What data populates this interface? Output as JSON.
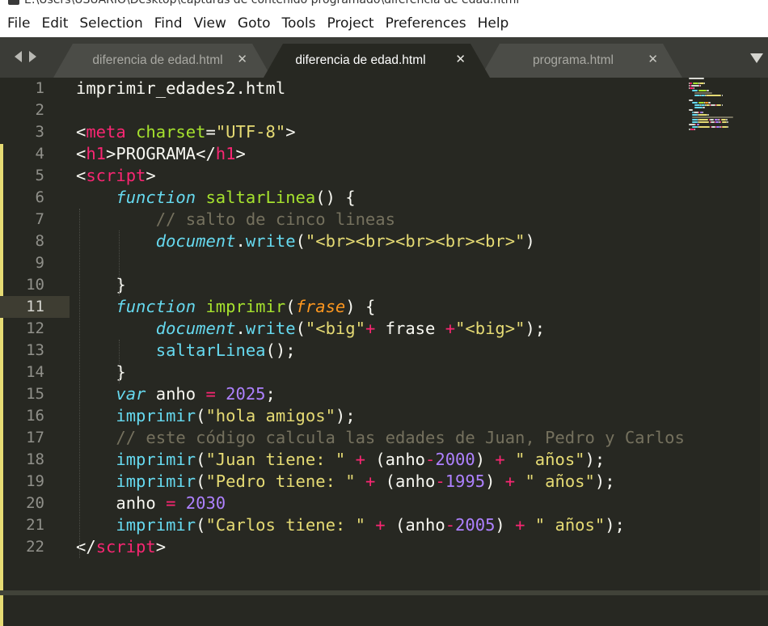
{
  "window": {
    "title": "E:\\Users\\USUARIO\\Desktop\\capturas de contenido programado\\diferencia de edad.html"
  },
  "menu": [
    "File",
    "Edit",
    "Selection",
    "Find",
    "View",
    "Goto",
    "Tools",
    "Project",
    "Preferences",
    "Help"
  ],
  "tabs": [
    {
      "label": "diferencia de edad.html",
      "active": false
    },
    {
      "label": "diferencia de edad.html",
      "active": true
    },
    {
      "label": "programa.html",
      "active": false
    }
  ],
  "tab_close_glyph": "✕",
  "editor": {
    "current_line": 11,
    "lines": [
      {
        "n": "1",
        "tokens": [
          [
            "t",
            "imprimir_edades2.html"
          ]
        ]
      },
      {
        "n": "2",
        "tokens": []
      },
      {
        "n": "3",
        "tokens": [
          [
            "t",
            "<"
          ],
          [
            "kw",
            "meta"
          ],
          [
            "t",
            " "
          ],
          [
            "attr",
            "charset"
          ],
          [
            "t",
            "="
          ],
          [
            "str",
            "\"UTF-8\""
          ],
          [
            "t",
            ">"
          ]
        ]
      },
      {
        "n": "4",
        "tokens": [
          [
            "t",
            "<"
          ],
          [
            "kw",
            "h1"
          ],
          [
            "t",
            ">PROGRAMA</"
          ],
          [
            "kw",
            "h1"
          ],
          [
            "t",
            ">"
          ]
        ]
      },
      {
        "n": "5",
        "tokens": [
          [
            "t",
            "<"
          ],
          [
            "kw",
            "script"
          ],
          [
            "t",
            ">"
          ]
        ]
      },
      {
        "n": "6",
        "tokens": [
          [
            "t",
            "    "
          ],
          [
            "fn",
            "function"
          ],
          [
            "t",
            " "
          ],
          [
            "fname",
            "saltarLinea"
          ],
          [
            "t",
            "() {"
          ]
        ]
      },
      {
        "n": "7",
        "tokens": [
          [
            "t",
            "        "
          ],
          [
            "com",
            "// salto de cinco lineas"
          ]
        ]
      },
      {
        "n": "8",
        "tokens": [
          [
            "t",
            "        "
          ],
          [
            "fn",
            "document"
          ],
          [
            "t",
            "."
          ],
          [
            "call",
            "write"
          ],
          [
            "t",
            "("
          ],
          [
            "str",
            "\"<br><br><br><br><br>\""
          ],
          [
            "t",
            ")"
          ]
        ]
      },
      {
        "n": "9",
        "tokens": []
      },
      {
        "n": "10",
        "tokens": [
          [
            "t",
            "    }"
          ]
        ]
      },
      {
        "n": "11",
        "tokens": [
          [
            "t",
            "    "
          ],
          [
            "fn",
            "function"
          ],
          [
            "t",
            " "
          ],
          [
            "fname",
            "imprimir"
          ],
          [
            "t",
            "("
          ],
          [
            "param",
            "frase"
          ],
          [
            "t",
            ") {"
          ]
        ]
      },
      {
        "n": "12",
        "tokens": [
          [
            "t",
            "        "
          ],
          [
            "fn",
            "document"
          ],
          [
            "t",
            "."
          ],
          [
            "call",
            "write"
          ],
          [
            "t",
            "("
          ],
          [
            "str",
            "\"<big\""
          ],
          [
            "kw",
            "+"
          ],
          [
            "t",
            " frase "
          ],
          [
            "kw",
            "+"
          ],
          [
            "str",
            "\"<big>\""
          ],
          [
            "t",
            ");"
          ]
        ]
      },
      {
        "n": "13",
        "tokens": [
          [
            "t",
            "        "
          ],
          [
            "call",
            "saltarLinea"
          ],
          [
            "t",
            "();"
          ]
        ]
      },
      {
        "n": "14",
        "tokens": [
          [
            "t",
            "    }"
          ]
        ]
      },
      {
        "n": "15",
        "tokens": [
          [
            "t",
            "    "
          ],
          [
            "fn",
            "var"
          ],
          [
            "t",
            " anho "
          ],
          [
            "kw",
            "="
          ],
          [
            "t",
            " "
          ],
          [
            "num",
            "2025"
          ],
          [
            "t",
            ";"
          ]
        ]
      },
      {
        "n": "16",
        "tokens": [
          [
            "t",
            "    "
          ],
          [
            "call",
            "imprimir"
          ],
          [
            "t",
            "("
          ],
          [
            "str",
            "\"hola amigos\""
          ],
          [
            "t",
            ");"
          ]
        ]
      },
      {
        "n": "17",
        "tokens": [
          [
            "t",
            "    "
          ],
          [
            "com",
            "// este código calcula las edades de Juan, Pedro y Carlos"
          ]
        ]
      },
      {
        "n": "18",
        "tokens": [
          [
            "t",
            "    "
          ],
          [
            "call",
            "imprimir"
          ],
          [
            "t",
            "("
          ],
          [
            "str",
            "\"Juan tiene: \""
          ],
          [
            "t",
            " "
          ],
          [
            "kw",
            "+"
          ],
          [
            "t",
            " (anho"
          ],
          [
            "kw",
            "-"
          ],
          [
            "num",
            "2000"
          ],
          [
            "t",
            ") "
          ],
          [
            "kw",
            "+"
          ],
          [
            "t",
            " "
          ],
          [
            "str",
            "\" años\""
          ],
          [
            "t",
            ");"
          ]
        ]
      },
      {
        "n": "19",
        "tokens": [
          [
            "t",
            "    "
          ],
          [
            "call",
            "imprimir"
          ],
          [
            "t",
            "("
          ],
          [
            "str",
            "\"Pedro tiene: \""
          ],
          [
            "t",
            " "
          ],
          [
            "kw",
            "+"
          ],
          [
            "t",
            " (anho"
          ],
          [
            "kw",
            "-"
          ],
          [
            "num",
            "1995"
          ],
          [
            "t",
            ") "
          ],
          [
            "kw",
            "+"
          ],
          [
            "t",
            " "
          ],
          [
            "str",
            "\" años\""
          ],
          [
            "t",
            ");"
          ]
        ]
      },
      {
        "n": "20",
        "tokens": [
          [
            "t",
            "    anho "
          ],
          [
            "kw",
            "="
          ],
          [
            "t",
            " "
          ],
          [
            "num",
            "2030"
          ]
        ]
      },
      {
        "n": "21",
        "tokens": [
          [
            "t",
            "    "
          ],
          [
            "call",
            "imprimir"
          ],
          [
            "t",
            "("
          ],
          [
            "str",
            "\"Carlos tiene: \""
          ],
          [
            "t",
            " "
          ],
          [
            "kw",
            "+"
          ],
          [
            "t",
            " (anho"
          ],
          [
            "kw",
            "-"
          ],
          [
            "num",
            "2005"
          ],
          [
            "t",
            ") "
          ],
          [
            "kw",
            "+"
          ],
          [
            "t",
            " "
          ],
          [
            "str",
            "\" años\""
          ],
          [
            "t",
            ");"
          ]
        ]
      },
      {
        "n": "22",
        "tokens": [
          [
            "t",
            "</"
          ],
          [
            "kw",
            "script"
          ],
          [
            "t",
            ">"
          ]
        ]
      }
    ]
  },
  "colors": {
    "background": "#272822",
    "tag": "#f92672",
    "attribute": "#a6e22e",
    "string": "#e6db74",
    "storage": "#66d9ef",
    "parameter": "#fd971f",
    "comment": "#75715e",
    "number": "#ae81ff"
  }
}
